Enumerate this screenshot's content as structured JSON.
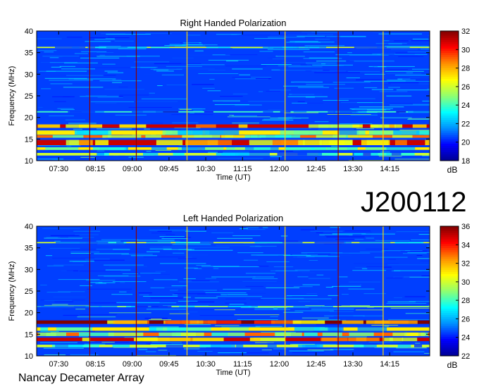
{
  "event_code": "J200112",
  "observatory": "Nancay Decameter Array",
  "chart_data": [
    {
      "type": "heatmap",
      "title": "Right Handed Polarization",
      "xlabel": "Time (UT)",
      "ylabel": "Frequency (MHz)",
      "xticks": [
        "07:30",
        "08:15",
        "09:00",
        "09:45",
        "10:30",
        "11:15",
        "12:00",
        "12:45",
        "13:30",
        "14:15"
      ],
      "xlim": [
        "07:03",
        "15:04"
      ],
      "ylim": [
        10,
        40
      ],
      "yticks": [
        10,
        15,
        20,
        25,
        30,
        35,
        40
      ],
      "colorbar_label": "dB",
      "colorbar_range": [
        18,
        32
      ],
      "colorbar_ticks": [
        18,
        20,
        22,
        24,
        26,
        28,
        30,
        32
      ],
      "colormap": [
        "#000090",
        "#0000ff",
        "#0090ff",
        "#00ffff",
        "#90ff70",
        "#ffff00",
        "#ff9000",
        "#ff0000",
        "#800000"
      ],
      "vertical_lines": [
        {
          "time": "08:08",
          "color": "#8b0000"
        },
        {
          "time": "09:05",
          "color": "#8b0000"
        },
        {
          "time": "10:07",
          "color": "#ffd400"
        },
        {
          "time": "12:07",
          "color": "#ffd400"
        },
        {
          "time": "13:12",
          "color": "#8b0000"
        },
        {
          "time": "14:07",
          "color": "#ffd400"
        }
      ],
      "emission_bands": [
        {
          "freq_mhz": 18.0,
          "level_db": 31,
          "width_mhz": 0.8
        },
        {
          "freq_mhz": 16.5,
          "level_db": 27,
          "width_mhz": 1.0
        },
        {
          "freq_mhz": 15.6,
          "level_db": 29,
          "width_mhz": 0.6
        },
        {
          "freq_mhz": 14.2,
          "level_db": 31,
          "width_mhz": 1.2
        },
        {
          "freq_mhz": 12.8,
          "level_db": 27,
          "width_mhz": 0.6
        },
        {
          "freq_mhz": 11.5,
          "level_db": 26,
          "width_mhz": 0.6
        },
        {
          "freq_mhz": 21.3,
          "level_db": 24,
          "width_mhz": 0.3
        },
        {
          "freq_mhz": 36.2,
          "level_db": 26,
          "width_mhz": 0.3
        }
      ]
    },
    {
      "type": "heatmap",
      "title": "Left Handed Polarization",
      "xlabel": "Time (UT)",
      "ylabel": "Frequency (MHz)",
      "xticks": [
        "07:30",
        "08:15",
        "09:00",
        "09:45",
        "10:30",
        "11:15",
        "12:00",
        "12:45",
        "13:30",
        "14:15"
      ],
      "xlim": [
        "07:03",
        "15:04"
      ],
      "ylim": [
        10,
        40
      ],
      "yticks": [
        10,
        15,
        20,
        25,
        30,
        35,
        40
      ],
      "colorbar_label": "dB",
      "colorbar_range": [
        22,
        36
      ],
      "colorbar_ticks": [
        22,
        24,
        26,
        28,
        30,
        32,
        34,
        36
      ],
      "colormap": [
        "#000090",
        "#0000ff",
        "#0090ff",
        "#00ffff",
        "#90ff70",
        "#ffff00",
        "#ff9000",
        "#ff0000",
        "#800000"
      ],
      "vertical_lines": [
        {
          "time": "08:08",
          "color": "#8b0000"
        },
        {
          "time": "09:05",
          "color": "#8b0000"
        },
        {
          "time": "10:07",
          "color": "#ffd400"
        },
        {
          "time": "12:07",
          "color": "#ffd400"
        },
        {
          "time": "13:12",
          "color": "#8b0000"
        },
        {
          "time": "14:07",
          "color": "#ffd400"
        }
      ],
      "emission_bands": [
        {
          "freq_mhz": 17.8,
          "level_db": 36,
          "width_mhz": 0.8
        },
        {
          "freq_mhz": 16.2,
          "level_db": 31,
          "width_mhz": 0.8
        },
        {
          "freq_mhz": 15.0,
          "level_db": 33,
          "width_mhz": 0.8
        },
        {
          "freq_mhz": 13.8,
          "level_db": 35,
          "width_mhz": 0.8
        },
        {
          "freq_mhz": 12.3,
          "level_db": 30,
          "width_mhz": 0.6
        },
        {
          "freq_mhz": 21.4,
          "level_db": 29,
          "width_mhz": 0.3
        },
        {
          "freq_mhz": 36.2,
          "level_db": 30,
          "width_mhz": 0.3
        }
      ]
    }
  ]
}
